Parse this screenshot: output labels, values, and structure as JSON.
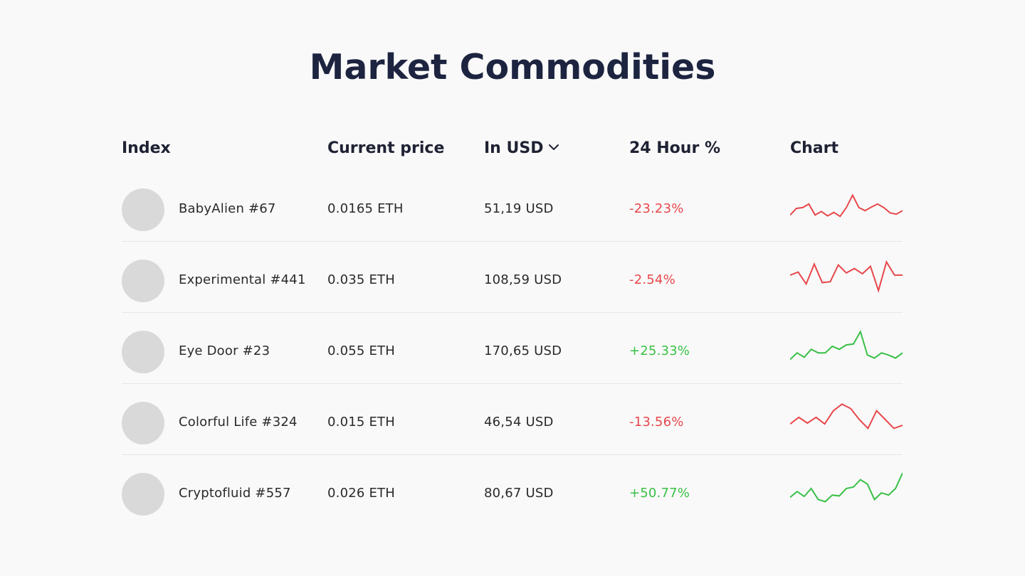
{
  "title": "Market Commodities",
  "columns": {
    "index": "Index",
    "price": "Current price",
    "usd": "In USD",
    "change": "24 Hour %",
    "chart": "Chart"
  },
  "colors": {
    "negative": "#e8474b",
    "positive": "#39c046",
    "title": "#1d2440"
  },
  "rows": [
    {
      "name": "BabyAlien #67",
      "price": "0.0165 ETH",
      "usd": "51,19 USD",
      "change": "-23.23%",
      "trend": "negative",
      "spark": [
        0.3,
        0.45,
        0.47,
        0.55,
        0.3,
        0.38,
        0.28,
        0.36,
        0.27,
        0.47,
        0.75,
        0.47,
        0.4,
        0.48,
        0.55,
        0.47,
        0.35,
        0.32,
        0.4
      ]
    },
    {
      "name": "Experimental #441",
      "price": "0.035 ETH",
      "usd": "108,59 USD",
      "change": "-2.54%",
      "trend": "negative",
      "spark": [
        0.55,
        0.62,
        0.35,
        0.8,
        0.38,
        0.4,
        0.78,
        0.6,
        0.7,
        0.58,
        0.75,
        0.2,
        0.85,
        0.55,
        0.55
      ]
    },
    {
      "name": "Eye Door #23",
      "price": "0.055 ETH",
      "usd": "170,65 USD",
      "change": "+25.33%",
      "trend": "positive",
      "spark": [
        0.25,
        0.4,
        0.3,
        0.48,
        0.4,
        0.4,
        0.55,
        0.48,
        0.58,
        0.6,
        0.88,
        0.35,
        0.28,
        0.4,
        0.35,
        0.28,
        0.4
      ]
    },
    {
      "name": "Colorful Life #324",
      "price": "0.015 ETH",
      "usd": "46,54 USD",
      "change": "-13.56%",
      "trend": "negative",
      "spark": [
        0.4,
        0.55,
        0.42,
        0.55,
        0.4,
        0.7,
        0.85,
        0.75,
        0.5,
        0.3,
        0.7,
        0.5,
        0.3,
        0.37
      ]
    },
    {
      "name": "Cryptofluid #557",
      "price": "0.026 ETH",
      "usd": "80,67 USD",
      "change": "+50.77%",
      "trend": "positive",
      "spark": [
        0.35,
        0.48,
        0.37,
        0.55,
        0.3,
        0.25,
        0.4,
        0.38,
        0.55,
        0.58,
        0.75,
        0.65,
        0.3,
        0.45,
        0.4,
        0.55,
        0.9
      ]
    }
  ]
}
